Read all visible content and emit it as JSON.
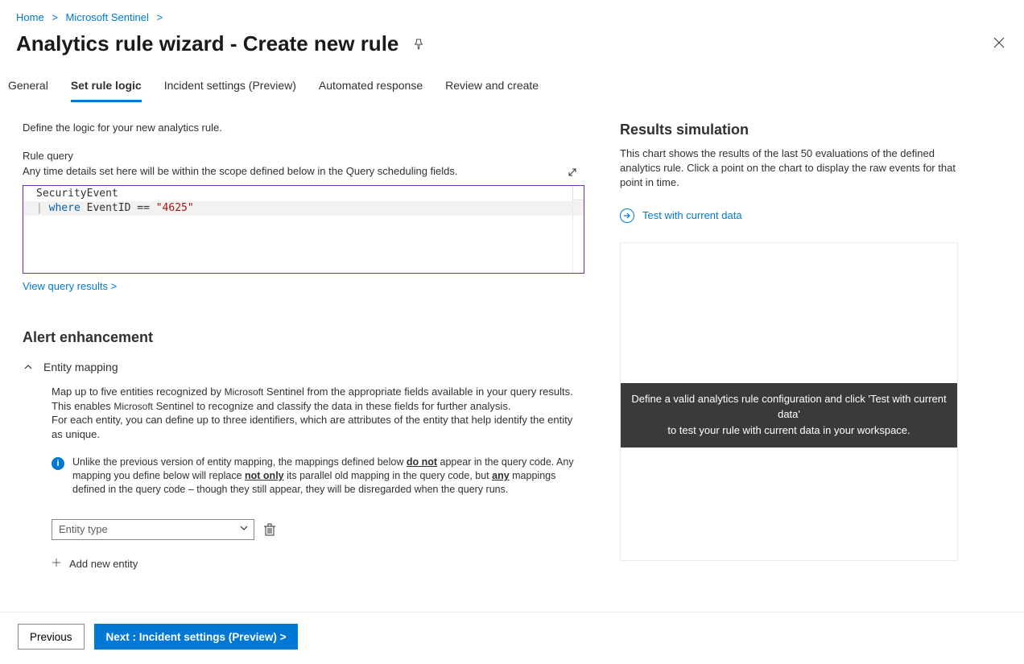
{
  "breadcrumb": {
    "home": "Home",
    "sentinel": "Microsoft Sentinel"
  },
  "page": {
    "title": "Analytics rule wizard - Create new rule"
  },
  "tabs": {
    "general": "General",
    "set_rule_logic": "Set rule logic",
    "incident_settings": "Incident settings (Preview)",
    "automated_response": "Automated response",
    "review_create": "Review and create"
  },
  "left": {
    "intro": "Define the logic for your new analytics rule.",
    "rule_query_label": "Rule query",
    "rule_query_sub": "Any time details set here will be within the scope defined below in the Query scheduling fields.",
    "query": {
      "line1_table": "SecurityEvent",
      "line2_where": "where",
      "line2_field": "EventID",
      "line2_op": "==",
      "line2_value": "\"4625\""
    },
    "view_results": "View query results >",
    "alert_enhancement": "Alert enhancement",
    "entity_mapping_title": "Entity mapping",
    "entity_mapping_desc_1": "Map up to five entities recognized by ",
    "entity_mapping_desc_ms": "Microsoft",
    "entity_mapping_desc_2": " Sentinel from the appropriate fields available in your query results. This enables ",
    "entity_mapping_desc_3_ms": "Microsoft",
    "entity_mapping_desc_3": " Sentinel to recognize and classify the data in these fields for further analysis.",
    "entity_mapping_desc_4": "For each entity, you can define up to three identifiers, which are attributes of the entity that help identify the entity as unique.",
    "info_1": "Unlike the previous version of entity mapping, the mappings defined below ",
    "info_do_not": "do not",
    "info_2": " appear in the query code. Any mapping you define below will replace ",
    "info_not_only": "not only",
    "info_3": " its parallel old mapping in the query code, but ",
    "info_any": "any",
    "info_4": " mappings defined in the query code – though they still appear, they will be disregarded when the query runs.",
    "entity_type_placeholder": "Entity type",
    "add_new_entity": "Add new entity"
  },
  "right": {
    "title": "Results simulation",
    "desc": "This chart shows the results of the last 50 evaluations of the defined analytics rule. Click a point on the chart to display the raw events for that point in time.",
    "test_link": "Test with current data",
    "overlay_1": "Define a valid analytics rule configuration and click 'Test with current data'",
    "overlay_2": "to test your rule with current data in your workspace."
  },
  "footer": {
    "previous": "Previous",
    "next": "Next : Incident settings (Preview) >"
  }
}
